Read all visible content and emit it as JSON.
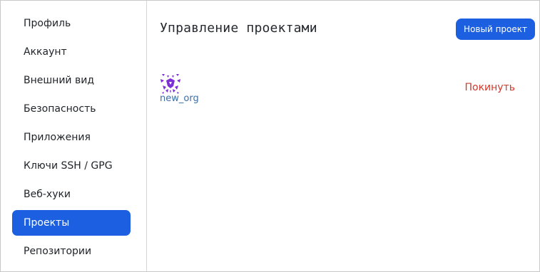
{
  "sidebar": {
    "items": [
      {
        "label": "Профиль"
      },
      {
        "label": "Аккаунт"
      },
      {
        "label": "Внешний вид"
      },
      {
        "label": "Безопасность"
      },
      {
        "label": "Приложения"
      },
      {
        "label": "Ключи SSH / GPG"
      },
      {
        "label": "Веб-хуки"
      },
      {
        "label": "Проекты",
        "active": true
      },
      {
        "label": "Репозитории"
      }
    ]
  },
  "main": {
    "title": "Управление проектами",
    "new_project_label": "Новый проект",
    "orgs": [
      {
        "name": "new_org",
        "avatar_icon": "identicon-avatar",
        "avatar_color": "#7b2fd6",
        "leave_label": "Покинуть"
      }
    ]
  },
  "colors": {
    "accent": "#1c5fe0",
    "danger": "#d0392b",
    "link": "#3a6ea8"
  }
}
